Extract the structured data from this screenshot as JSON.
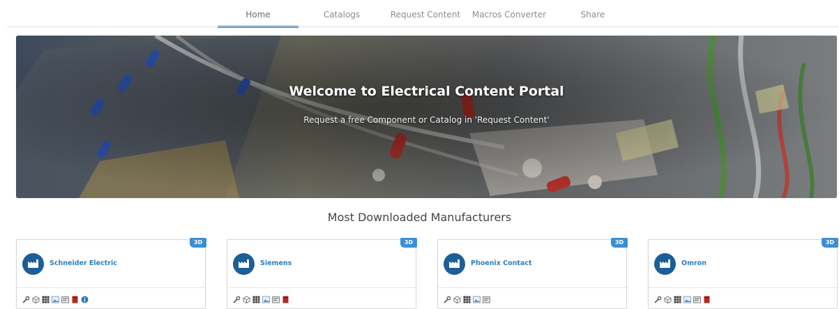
{
  "nav": {
    "tabs": [
      {
        "label": "Home",
        "active": true
      },
      {
        "label": "Catalogs",
        "active": false
      },
      {
        "label": "Request Content",
        "active": false
      },
      {
        "label": "Macros Converter",
        "active": false
      },
      {
        "label": "Share",
        "active": false
      }
    ]
  },
  "hero": {
    "title": "Welcome to Electrical Content Portal",
    "subtitle": "Request a free Component or Catalog in 'Request Content'"
  },
  "section": {
    "title": "Most Downloaded Manufacturers"
  },
  "manufacturers": [
    {
      "name": "Schneider Electric",
      "badge": "3D",
      "icons": [
        "wrench-icon",
        "cube-icon",
        "grid-icon",
        "image-icon",
        "box-icon",
        "book-icon",
        "info-icon"
      ]
    },
    {
      "name": "Siemens",
      "badge": "3D",
      "icons": [
        "wrench-icon",
        "cube-icon",
        "grid-icon",
        "image-icon",
        "box-icon",
        "book-icon"
      ]
    },
    {
      "name": "Phoenix Contact",
      "badge": "3D",
      "icons": [
        "wrench-icon",
        "cube-icon",
        "grid-icon",
        "image-icon",
        "box-icon"
      ]
    },
    {
      "name": "Omron",
      "badge": "3D",
      "icons": [
        "wrench-icon",
        "cube-icon",
        "grid-icon",
        "image-icon",
        "box-icon",
        "book-icon"
      ]
    }
  ],
  "colors": {
    "accent": "#2e7ab8",
    "badge": "#3a8fd4",
    "avatar": "#1b5e98",
    "link": "#2a7fc1"
  }
}
